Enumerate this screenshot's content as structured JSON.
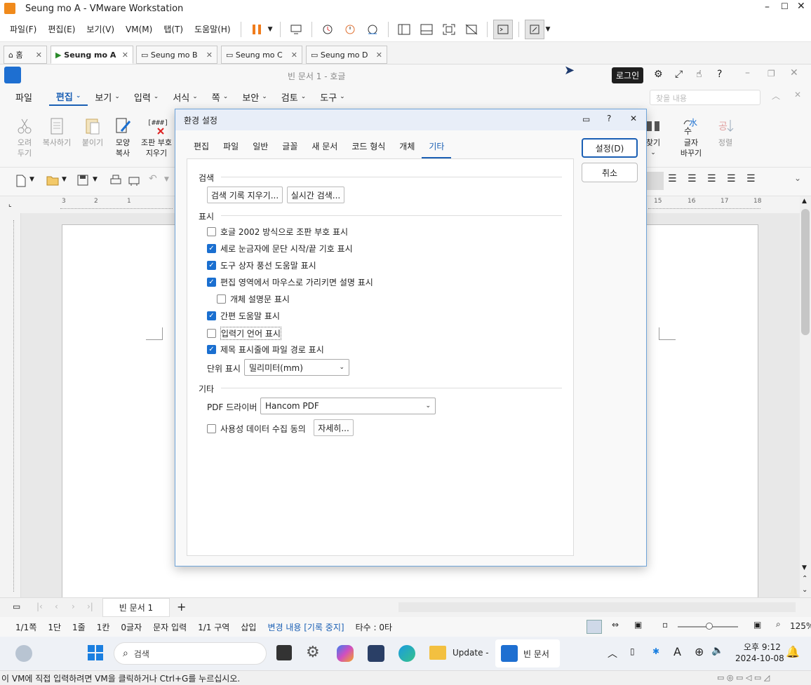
{
  "vmware": {
    "title": "Seung mo A - VMware Workstation",
    "menu": [
      "파일(F)",
      "편집(E)",
      "보기(V)",
      "VM(M)",
      "탭(T)",
      "도움말(H)"
    ],
    "tabs": [
      {
        "label": "홈"
      },
      {
        "label": "Seung mo A"
      },
      {
        "label": "Seung mo B"
      },
      {
        "label": "Seung mo C"
      },
      {
        "label": "Seung mo D"
      }
    ],
    "status_hint": "이 VM에 직접 입력하려면 VM을 클릭하거나 Ctrl+G를 누르십시오."
  },
  "hwp": {
    "title": "빈 문서 1 - 호글",
    "login": "로그인",
    "menu": [
      "파일",
      "편집",
      "보기",
      "입력",
      "서식",
      "쪽",
      "보안",
      "검토",
      "도구"
    ],
    "search_placeholder": "찾을 내용",
    "ribbon": {
      "cut": [
        "오려",
        "두기"
      ],
      "copy": "복사하기",
      "paste": "붙이기",
      "shape_copy": [
        "모양",
        "복사"
      ],
      "erase_code": [
        "조판 부호",
        "지우기"
      ],
      "find": "찾기",
      "replace": [
        "글자",
        "바꾸기"
      ],
      "sort": "정렬"
    },
    "ruler_nums": [
      "3",
      "2",
      "1",
      "15",
      "16",
      "17",
      "18"
    ],
    "doc_tab": "빈 문서 1",
    "status": [
      "1/1쪽",
      "1단",
      "1줄",
      "1칸",
      "0글자",
      "문자 입력",
      "1/1 구역",
      "삽입",
      "변경 내용 [기록 중지]",
      "타수 : 0타"
    ],
    "zoom": "125%"
  },
  "dialog": {
    "title": "환경 설정",
    "tabs": [
      "편집",
      "파일",
      "일반",
      "글꼴",
      "새 문서",
      "코드 형식",
      "개체",
      "기타"
    ],
    "active_tab": "기타",
    "ok": "설정(D)",
    "cancel": "취소",
    "search_section": "검색",
    "clear_history": "검색 기록 지우기...",
    "realtime_search": "실시간 검색...",
    "display_section": "표시",
    "checks": [
      {
        "label": "호글 2002 방식으로 조판 부호 표시",
        "checked": false
      },
      {
        "label": "세로 눈금자에 문단 시작/끝 기호 표시",
        "checked": true
      },
      {
        "label": "도구 상자 풍선 도움말 표시",
        "checked": true
      },
      {
        "label": "편집 영역에서 마우스로 가리키면 설명 표시",
        "checked": true
      },
      {
        "label": "개체 설명문 표시",
        "checked": false
      },
      {
        "label": "간편 도움말 표시",
        "checked": true
      },
      {
        "label": "입력기 언어 표시",
        "checked": false
      },
      {
        "label": "제목 표시줄에 파일 경로 표시",
        "checked": true
      }
    ],
    "unit_label": "단위 표시",
    "unit_value": "밀리미터(mm)",
    "etc_section": "기타",
    "pdf_label": "PDF 드라이버",
    "pdf_value": "Hancom PDF",
    "usage_label": "사용성 데이터 수집 동의",
    "detail": "자세히..."
  },
  "taskbar": {
    "search": "검색",
    "app1": "Update -",
    "app2": "빈 문서",
    "time": "오후 9:12",
    "date": "2024-10-08"
  }
}
